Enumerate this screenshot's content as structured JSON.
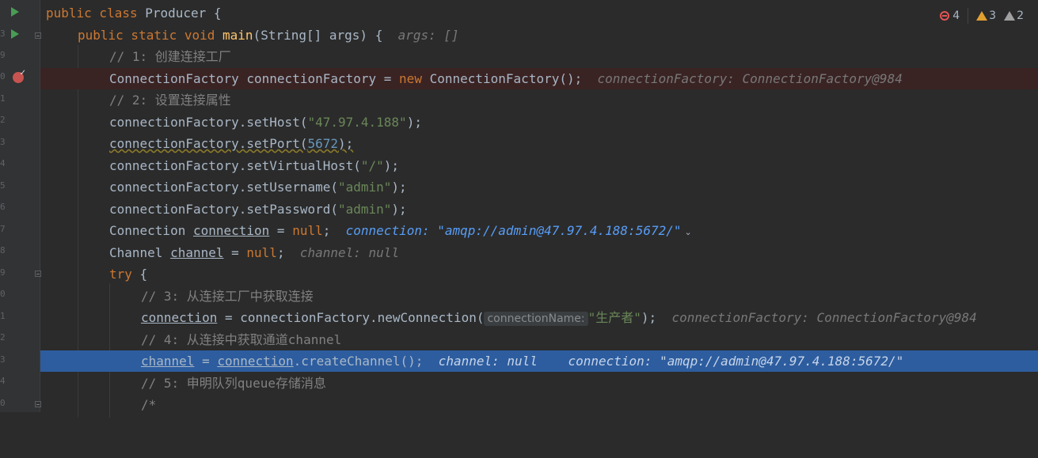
{
  "status": {
    "errors": "4",
    "warnings": "3",
    "weak_warnings": "2"
  },
  "gutter": {
    "line_fragments": [
      "3",
      "",
      "9",
      "0",
      "1",
      "2",
      "3",
      "4",
      "5",
      "6",
      "7",
      "8",
      "9",
      "0",
      "1",
      "2",
      "3",
      "4",
      "0"
    ]
  },
  "code": {
    "l1_kw": "public class",
    "l1_rest": " Producer {",
    "l2_kw": "public static void",
    "l2_fn": "main",
    "l2_rest": "(String[] args) {",
    "l2_hint": "args: []",
    "l3": "// 1: 创建连接工厂",
    "l4_a": "ConnectionFactory connectionFactory = ",
    "l4_kw": "new",
    "l4_b": " ConnectionFactory();",
    "l4_hint": "connectionFactory: ConnectionFactory@984",
    "l5": "// 2: 设置连接属性",
    "l6_a": "connectionFactory.setHost(",
    "l6_str": "\"47.97.4.188\"",
    "l6_b": ");",
    "l7_a": "connectionFactory.setPort(",
    "l7_num": "5672",
    "l7_b": ");",
    "l8_a": "connectionFactory.setVirtualHost(",
    "l8_str": "\"/\"",
    "l8_b": ");",
    "l9_a": "connectionFactory.setUsername(",
    "l9_str": "\"admin\"",
    "l9_b": ");",
    "l10_a": "connectionFactory.setPassword(",
    "l10_str": "\"admin\"",
    "l10_b": ");",
    "l11_a": "Connection ",
    "l11_var": "connection",
    "l11_b": " = ",
    "l11_kw": "null",
    "l11_c": ";",
    "l11_hint": "connection: \"amqp://admin@47.97.4.188:5672/\"",
    "l12_a": "Channel ",
    "l12_var": "channel",
    "l12_b": " = ",
    "l12_kw": "null",
    "l12_c": ";",
    "l12_hint": "channel: null",
    "l13_kw": "try",
    "l13_b": " {",
    "l14": "// 3: 从连接工厂中获取连接",
    "l15_var": "connection",
    "l15_a": " = connectionFactory.newConnection(",
    "l15_param": "connectionName:",
    "l15_str": "\"生产者\"",
    "l15_b": ");",
    "l15_hint": "connectionFactory: ConnectionFactory@984",
    "l16": "// 4: 从连接中获取通道channel",
    "l17_var": "channel",
    "l17_a": " = ",
    "l17_var2": "connection",
    "l17_b": ".createChannel();",
    "l17_hint1": "channel: null",
    "l17_hint2": "connection: \"amqp://admin@47.97.4.188:5672/\"",
    "l18": "// 5: 申明队列queue存储消息",
    "l19": "/*"
  }
}
